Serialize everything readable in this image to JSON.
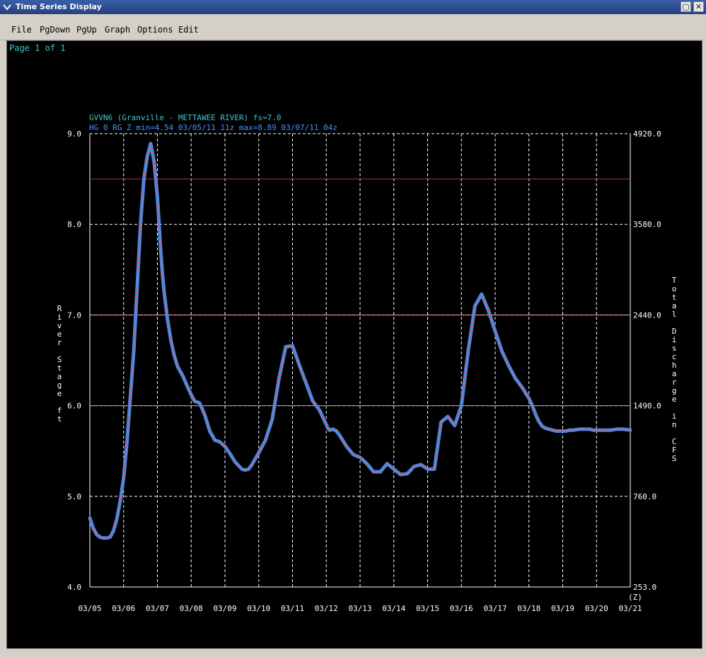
{
  "window": {
    "title": "Time Series Display",
    "menu": [
      "File",
      "PgDown",
      "PgUp",
      "Graph",
      "Options",
      "Edit"
    ]
  },
  "page_indicator": "Page 1 of 1",
  "colors": {
    "background": "#000000",
    "grid": "#ffffff",
    "header_station": "#3cc8c8",
    "header_series": "#4a90ff",
    "series_line": "#3d8ce8",
    "series_points": "#ff5050",
    "threshold_action": "#c8a080",
    "threshold_minor": "#ff9080",
    "threshold_major": "#c03030"
  },
  "chart_data": {
    "type": "line",
    "station_title": "GVVN6 (Granville - METTAWEE RIVER) fs=7.0",
    "series_title": "HG 0 RG Z min=4.54 03/05/11 11z max=8.89 03/07/11 04z",
    "ylabel_left": "River Stage ft",
    "ylabel_right": "Total Discharge in CFS",
    "xlabel_suffix": "(Z)",
    "ylim": [
      4.0,
      9.0
    ],
    "y_ticks_left": [
      "4.0",
      "5.0",
      "6.0",
      "7.0",
      "8.0",
      "9.0"
    ],
    "y_ticks_right": [
      "253.0",
      "760.0",
      "1490.0",
      "2440.0",
      "3580.0",
      "4920.0"
    ],
    "x_ticks": [
      "03/05",
      "03/06",
      "03/07",
      "03/08",
      "03/09",
      "03/10",
      "03/11",
      "03/12",
      "03/13",
      "03/14",
      "03/15",
      "03/16",
      "03/17",
      "03/18",
      "03/19",
      "03/20",
      "03/21"
    ],
    "grid": true,
    "thresholds": [
      {
        "value": 6.0,
        "color": "#c8a080"
      },
      {
        "value": 7.0,
        "color": "#ff9080"
      },
      {
        "value": 8.5,
        "color": "#c03030"
      }
    ],
    "series": [
      {
        "x_days": [
          0.0,
          0.1,
          0.2,
          0.3,
          0.4,
          0.5,
          0.6,
          0.7,
          0.8,
          0.9,
          1.0,
          1.1,
          1.2,
          1.3,
          1.4,
          1.5,
          1.6,
          1.7,
          1.8,
          1.9,
          2.0,
          2.05,
          2.1,
          2.15,
          2.2,
          2.3,
          2.4,
          2.5,
          2.6,
          2.75,
          2.9,
          3.0,
          3.1,
          3.25,
          3.4,
          3.55,
          3.7,
          3.85,
          4.0,
          4.15,
          4.3,
          4.5,
          4.6,
          4.7,
          4.8,
          5.0,
          5.2,
          5.4,
          5.6,
          5.8,
          6.0,
          6.2,
          6.4,
          6.5,
          6.6,
          6.8,
          6.9,
          7.0,
          7.05,
          7.1,
          7.2,
          7.3,
          7.4,
          7.5,
          7.6,
          7.8,
          8.0,
          8.2,
          8.4,
          8.6,
          8.8,
          9.0,
          9.2,
          9.4,
          9.6,
          9.8,
          10.0,
          10.2,
          10.4,
          10.6,
          10.8,
          11.0,
          11.2,
          11.4,
          11.6,
          11.8,
          12.0,
          12.2,
          12.4,
          12.6,
          12.8,
          13.0,
          13.1,
          13.2,
          13.3,
          13.4,
          13.5,
          13.6,
          13.7,
          13.8,
          13.9,
          14.0,
          14.1,
          14.2,
          14.3,
          14.5,
          14.6,
          14.7,
          14.8,
          14.9,
          15.0,
          15.2,
          15.4,
          15.6,
          15.8,
          16.0
        ],
        "values": [
          4.76,
          4.65,
          4.58,
          4.55,
          4.54,
          4.54,
          4.55,
          4.62,
          4.75,
          4.95,
          5.2,
          5.6,
          6.1,
          6.6,
          7.3,
          8.0,
          8.5,
          8.75,
          8.89,
          8.7,
          8.3,
          8.0,
          7.7,
          7.45,
          7.25,
          6.95,
          6.72,
          6.55,
          6.43,
          6.33,
          6.2,
          6.12,
          6.05,
          6.03,
          5.9,
          5.72,
          5.62,
          5.6,
          5.55,
          5.47,
          5.38,
          5.3,
          5.29,
          5.3,
          5.35,
          5.48,
          5.62,
          5.85,
          6.3,
          6.65,
          6.66,
          6.45,
          6.25,
          6.15,
          6.05,
          5.95,
          5.87,
          5.79,
          5.75,
          5.73,
          5.74,
          5.72,
          5.67,
          5.61,
          5.55,
          5.46,
          5.43,
          5.36,
          5.27,
          5.27,
          5.36,
          5.3,
          5.24,
          5.25,
          5.33,
          5.35,
          5.3,
          5.3,
          5.82,
          5.88,
          5.78,
          6.0,
          6.6,
          7.1,
          7.23,
          7.05,
          6.82,
          6.6,
          6.44,
          6.3,
          6.2,
          6.08,
          6.0,
          5.9,
          5.82,
          5.77,
          5.75,
          5.74,
          5.73,
          5.72,
          5.72,
          5.72,
          5.72,
          5.73,
          5.73,
          5.74,
          5.74,
          5.74,
          5.74,
          5.73,
          5.73,
          5.73,
          5.73,
          5.74,
          5.74,
          5.73
        ]
      }
    ]
  }
}
